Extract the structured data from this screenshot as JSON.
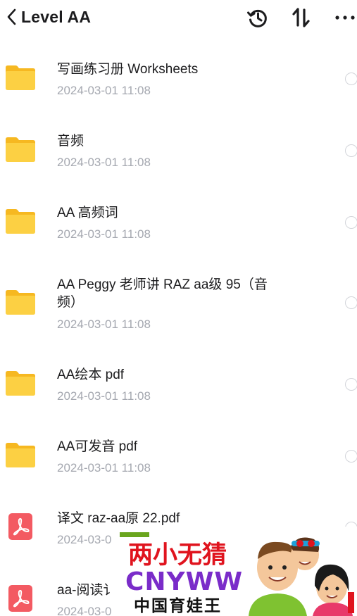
{
  "header": {
    "title": "Level AA",
    "icons": {
      "back": "chevron-left-icon",
      "history": "history-clock-icon",
      "sort": "sort-arrows-icon",
      "more": "more-dots-icon"
    }
  },
  "files": [
    {
      "type": "folder",
      "name": "写画练习册 Worksheets",
      "date": "2024-03-01 11:08"
    },
    {
      "type": "folder",
      "name": "音频",
      "date": "2024-03-01 11:08"
    },
    {
      "type": "folder",
      "name": "AA 高频词",
      "date": "2024-03-01 11:08"
    },
    {
      "type": "folder",
      "name": "AA Peggy 老师讲 RAZ aa级 95（音频）",
      "date": "2024-03-01 11:08"
    },
    {
      "type": "folder",
      "name": "AA绘本 pdf",
      "date": "2024-03-01 11:08"
    },
    {
      "type": "folder",
      "name": "AA可发音 pdf",
      "date": "2024-03-01 11:08"
    },
    {
      "type": "pdf",
      "name": "译文 raz-aa原 22.pdf",
      "date": "2024-03-0"
    },
    {
      "type": "pdf",
      "name": "aa-阅读讠",
      "date": "2024-03-0"
    }
  ],
  "watermark": {
    "line1": "两小无猜",
    "line2": "CNYWW",
    "line3": "中国育娃王",
    "colors": {
      "red": "#e0141e",
      "purple": "#7a2cc9",
      "green": "#6aa51e",
      "dark": "#111111"
    }
  },
  "colors": {
    "folder": "#fcd043",
    "folder_back": "#f6b821",
    "pdf": "#f35a62",
    "text": "#1c1c1e",
    "subtext": "#a5a8b0",
    "radio": "#d3d5da"
  }
}
